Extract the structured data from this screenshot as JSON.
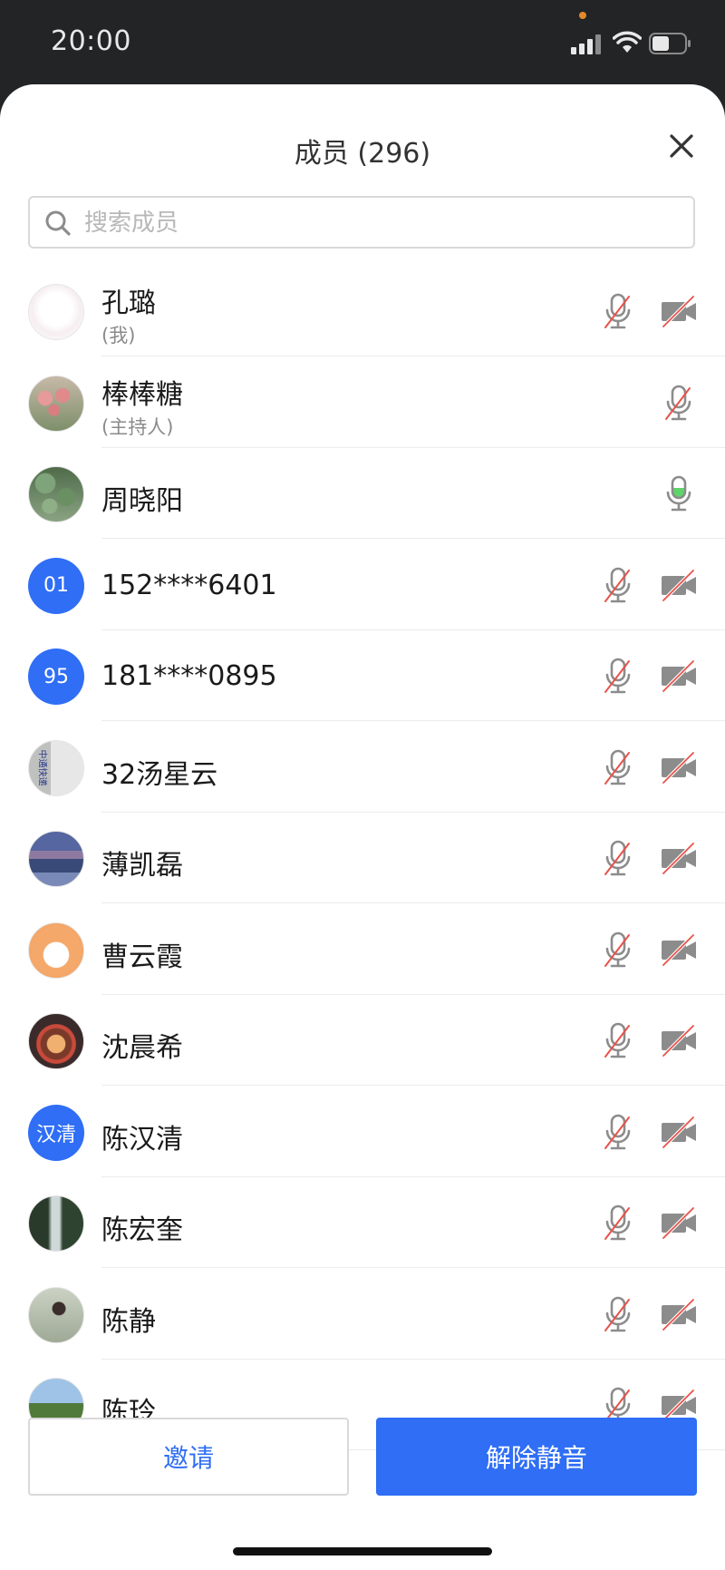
{
  "status_bar": {
    "time": "20:00"
  },
  "sheet": {
    "title": "成员 (296)",
    "search_placeholder": "搜索成员"
  },
  "members": [
    {
      "name": "孔璐",
      "role": "(我)",
      "avatar_type": "image",
      "avatar_desc": "bunny-sketch",
      "mic": "muted",
      "camera": "off"
    },
    {
      "name": "棒棒糖",
      "role": "(主持人)",
      "avatar_type": "image",
      "avatar_desc": "tulips",
      "mic": "muted",
      "camera": "none"
    },
    {
      "name": "周晓阳",
      "role": "",
      "avatar_type": "image",
      "avatar_desc": "green-leaves",
      "mic": "active",
      "camera": "none"
    },
    {
      "name": "152****6401",
      "role": "",
      "avatar_type": "text",
      "avatar_text": "01",
      "mic": "muted",
      "camera": "off"
    },
    {
      "name": "181****0895",
      "role": "",
      "avatar_type": "text",
      "avatar_text": "95",
      "mic": "muted",
      "camera": "off"
    },
    {
      "name": "32汤星云",
      "role": "",
      "avatar_type": "image",
      "avatar_desc": "express-package",
      "avatar_text": "中通快递",
      "mic": "muted",
      "camera": "off"
    },
    {
      "name": "薄凯磊",
      "role": "",
      "avatar_type": "image",
      "avatar_desc": "mountain-lake",
      "mic": "muted",
      "camera": "off"
    },
    {
      "name": "曹云霞",
      "role": "",
      "avatar_type": "image",
      "avatar_desc": "cartoon-dog",
      "mic": "muted",
      "camera": "off"
    },
    {
      "name": "沈晨希",
      "role": "",
      "avatar_type": "image",
      "avatar_desc": "tiger-badge",
      "mic": "muted",
      "camera": "off"
    },
    {
      "name": "陈汉清",
      "role": "",
      "avatar_type": "text",
      "avatar_text": "汉清",
      "mic": "muted",
      "camera": "off"
    },
    {
      "name": "陈宏奎",
      "role": "",
      "avatar_type": "image",
      "avatar_desc": "waterfall",
      "mic": "muted",
      "camera": "off"
    },
    {
      "name": "陈静",
      "role": "",
      "avatar_type": "image",
      "avatar_desc": "person-portrait",
      "mic": "muted",
      "camera": "off"
    },
    {
      "name": "陈玲",
      "role": "",
      "avatar_type": "image",
      "avatar_desc": "green-hills",
      "mic": "muted",
      "camera": "off"
    }
  ],
  "actions": {
    "invite_label": "邀请",
    "unmute_label": "解除静音"
  },
  "colors": {
    "accent": "#2f6ef5",
    "mic_active": "#5ed46a",
    "mute_slash": "#e8524a",
    "icon_gray": "#8c8c8c"
  }
}
